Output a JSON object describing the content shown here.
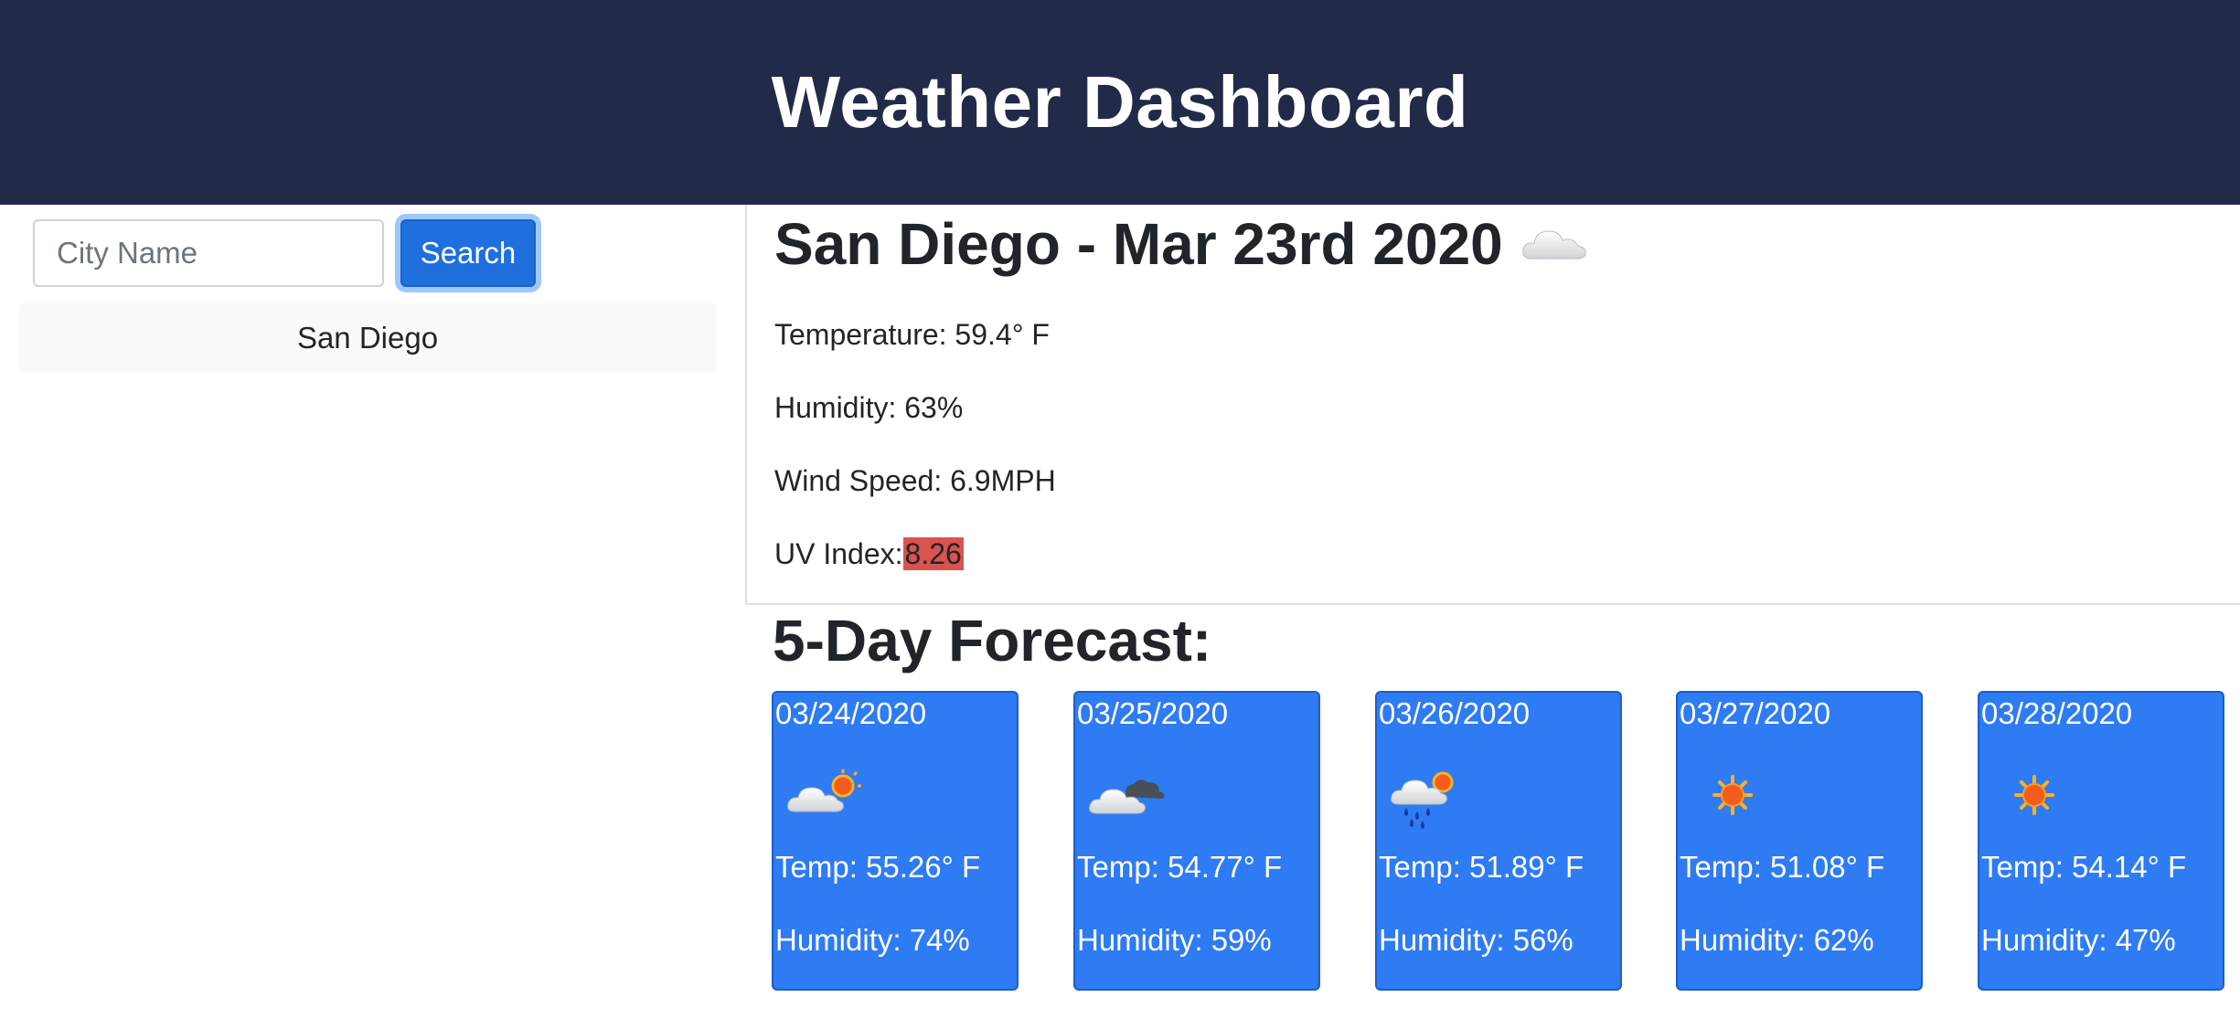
{
  "header": {
    "title": "Weather Dashboard"
  },
  "search": {
    "placeholder": "City Name",
    "value": "",
    "button_label": "Search"
  },
  "history": [
    {
      "label": "San Diego"
    }
  ],
  "current": {
    "title": "San Diego - Mar 23rd 2020",
    "icon": "cloud-icon",
    "temperature_label": "Temperature:",
    "temperature_value": "59.4° F",
    "humidity_label": "Humidity:",
    "humidity_value": "63%",
    "wind_label": "Wind Speed:",
    "wind_value": "6.9MPH",
    "uv_label": "UV Index:",
    "uv_value": "8.26"
  },
  "forecast": {
    "title": "5-Day Forecast:",
    "days": [
      {
        "date": "03/24/2020",
        "icon": "partly-cloudy-icon",
        "temp": "Temp: 55.26° F",
        "humidity": "Humidity: 74%"
      },
      {
        "date": "03/25/2020",
        "icon": "broken-clouds-icon",
        "temp": "Temp: 54.77° F",
        "humidity": "Humidity: 59%"
      },
      {
        "date": "03/26/2020",
        "icon": "rain-icon",
        "temp": "Temp: 51.89° F",
        "humidity": "Humidity: 56%"
      },
      {
        "date": "03/27/2020",
        "icon": "sun-icon",
        "temp": "Temp: 51.08° F",
        "humidity": "Humidity: 62%"
      },
      {
        "date": "03/28/2020",
        "icon": "sun-icon",
        "temp": "Temp: 54.14° F",
        "humidity": "Humidity: 47%"
      }
    ]
  },
  "colors": {
    "header_bg": "#222a49",
    "button_bg": "#1f6fde",
    "card_bg": "#2e7bf3",
    "uv_high": "#d9534f"
  }
}
